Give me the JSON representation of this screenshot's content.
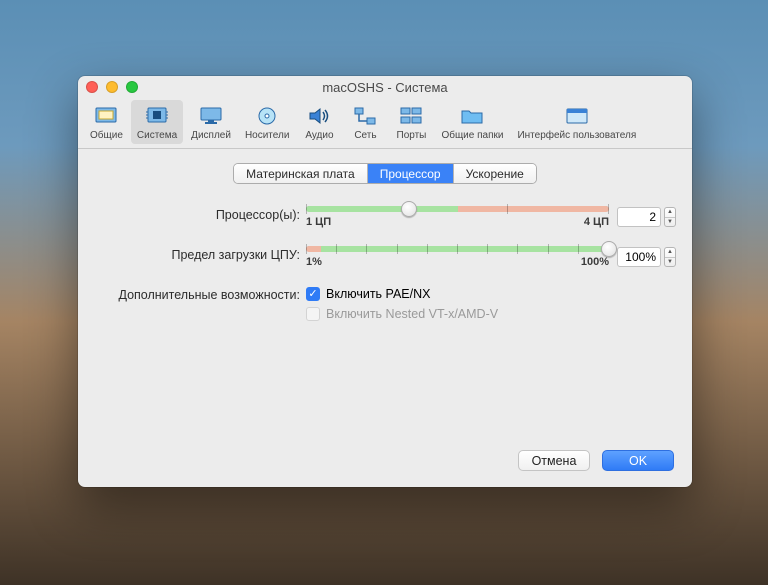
{
  "window_title": "macOSHS - Система",
  "toolbar": [
    {
      "id": "general",
      "label": "Общие"
    },
    {
      "id": "system",
      "label": "Система",
      "selected": true
    },
    {
      "id": "display",
      "label": "Дисплей"
    },
    {
      "id": "storage",
      "label": "Носители"
    },
    {
      "id": "audio",
      "label": "Аудио"
    },
    {
      "id": "network",
      "label": "Сеть"
    },
    {
      "id": "ports",
      "label": "Порты"
    },
    {
      "id": "shared",
      "label": "Общие папки"
    },
    {
      "id": "interface",
      "label": "Интерфейс пользователя"
    }
  ],
  "tabs": {
    "motherboard": "Материнская плата",
    "processor": "Процессор",
    "acceleration": "Ускорение",
    "active": "processor"
  },
  "fields": {
    "processors": {
      "label": "Процессор(ы):",
      "min_label": "1 ЦП",
      "max_label": "4 ЦП",
      "value": "2",
      "thumb_pct": 34
    },
    "exec_cap": {
      "label": "Предел загрузки ЦПУ:",
      "min_label": "1%",
      "max_label": "100%",
      "value": "100%",
      "thumb_pct": 100
    },
    "extra": {
      "label": "Дополнительные возможности:",
      "pae": "Включить PAE/NX",
      "nested": "Включить Nested VT-x/AMD-V"
    }
  },
  "buttons": {
    "cancel": "Отмена",
    "ok": "OK"
  }
}
